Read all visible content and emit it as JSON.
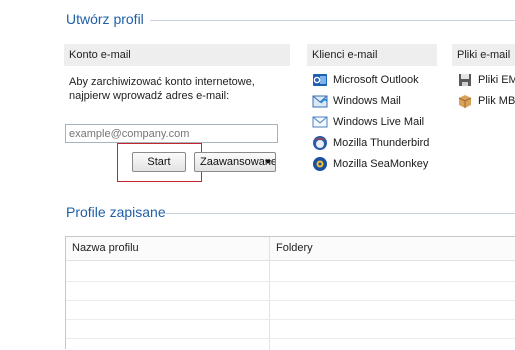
{
  "create_profile": {
    "title": "Utwórz profil",
    "email_account": {
      "header": "Konto e-mail",
      "description_line1": "Aby zarchiwizować konto internetowe,",
      "description_line2": "najpierw wprowadź adres e-mail:",
      "email_placeholder": "example@company.com",
      "start_label": "Start",
      "advanced_label": "Zaawansowane"
    },
    "email_clients": {
      "header": "Klienci e-mail",
      "items": [
        {
          "label": "Microsoft Outlook",
          "icon": "outlook-icon"
        },
        {
          "label": "Windows Mail",
          "icon": "windows-mail-icon"
        },
        {
          "label": "Windows Live Mail",
          "icon": "windows-live-mail-icon"
        },
        {
          "label": "Mozilla Thunderbird",
          "icon": "thunderbird-icon"
        },
        {
          "label": "Mozilla SeaMonkey",
          "icon": "seamonkey-icon"
        }
      ]
    },
    "email_files": {
      "header": "Pliki e-mail",
      "items": [
        {
          "label": "Pliki EML",
          "icon": "eml-file-icon"
        },
        {
          "label": "Plik MBOX",
          "icon": "mbox-file-icon"
        }
      ]
    }
  },
  "saved_profiles": {
    "title": "Profile zapisane",
    "columns": [
      "Nazwa profilu",
      "Foldery"
    ],
    "rows": []
  },
  "colors": {
    "section_title": "#1f5fa8",
    "highlight_border": "#c4262e",
    "panel_header_bg": "#eeeeee"
  }
}
